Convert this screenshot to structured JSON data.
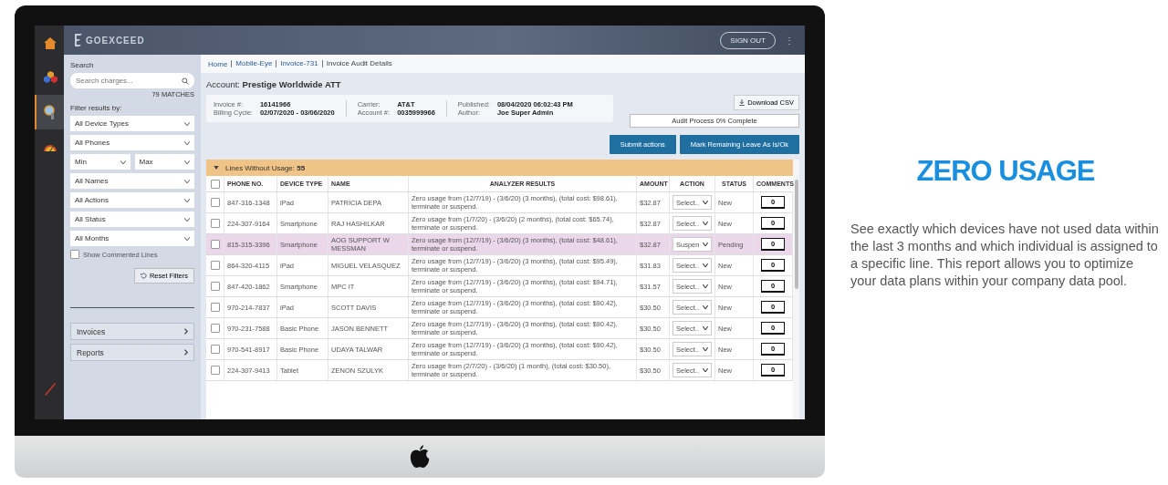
{
  "rail": [
    {
      "selected": false
    },
    {
      "selected": false
    },
    {
      "selected": true
    },
    {
      "selected": false
    },
    {
      "selected": false
    }
  ],
  "topbar": {
    "brand": "GOEXCEED",
    "sign_out": "SIGN OUT",
    "menu": "⋮"
  },
  "sidebar": {
    "search_label": "Search",
    "search": {
      "placeholder": "Search charges..."
    },
    "matches": "79 MATCHES",
    "filter_label": "Filter results by:",
    "filters": [
      {
        "kind": "select",
        "value": "All Device Types"
      },
      {
        "kind": "select",
        "value": "All Phones"
      },
      {
        "kind": "pair",
        "values": [
          "Min",
          "Max"
        ]
      },
      {
        "kind": "select",
        "value": "All Names"
      },
      {
        "kind": "select",
        "value": "All Actions"
      },
      {
        "kind": "select",
        "value": "All Status"
      },
      {
        "kind": "select",
        "value": "All Months"
      }
    ],
    "show_commented": {
      "label": "Show Commented Lines",
      "checked": false
    },
    "reset": "Reset Filters",
    "nav": [
      "Invoices",
      "Reports"
    ]
  },
  "breadcrumb": [
    {
      "label": "Home",
      "link": true
    },
    {
      "label": "Mobile-Eye",
      "link": true
    },
    {
      "label": "Invoice-731",
      "link": true
    },
    {
      "label": "Invoice Audit Details",
      "link": false
    }
  ],
  "account": "Account: **Prestige Worldwide ATT**",
  "invoice": [
    [
      {
        "label": "Invoice #:",
        "value": "16141966"
      },
      {
        "label": "Billing Cycle:",
        "value": "02/07/2020 - 03/06/2020"
      }
    ],
    [
      {
        "label": "Carrier:",
        "value": "AT&T"
      },
      {
        "label": "Account #:",
        "value": "0035999966"
      }
    ],
    [
      {
        "label": "Published:",
        "value": "08/04/2020 06:02:43 PM"
      },
      {
        "label": "Author:",
        "value": "Joe Super Admin"
      }
    ]
  ],
  "download": "Download CSV",
  "progress": {
    "label": "Audit Process 0% Complete",
    "level": 0
  },
  "actions": [
    "Submit actions",
    "Mark Remaining Leave As Is/Ok"
  ],
  "group": {
    "title": "Lines Without Usage: **55**",
    "expanded": true
  },
  "select_all": {
    "checked": false
  },
  "columns": [
    "PHONE NO.",
    "DEVICE TYPE",
    "NAME",
    "ANALYZER RESULTS",
    "AMOUNT",
    "ACTION",
    "STATUS",
    "COMMENTS"
  ],
  "rows": [
    {
      "phone": "847-316-1348",
      "device": "iPad",
      "name": "PATRICIA DEPA",
      "result": "Zero usage from (12/7/19) - (3/6/20) (3 months), (total cost: $98.61), terminate or suspend.",
      "amount": "$32.87",
      "action": "Select..",
      "status": "New",
      "comments": "0",
      "checked": false,
      "highlighted": false
    },
    {
      "phone": "224-307-9164",
      "device": "Smartphone",
      "name": "RAJ HASHILKAR",
      "result": "Zero usage from (1/7/20) - (3/6/20) (2 months), (total cost: $65.74), terminate or suspend.",
      "amount": "$32.87",
      "action": "Select..",
      "status": "New",
      "comments": "0",
      "checked": false,
      "highlighted": false
    },
    {
      "phone": "815-315-3396",
      "device": "Smartphone",
      "name": "AOG SUPPORT W MESSMAN",
      "result": "Zero usage from (12/7/19) - (3/6/20) (3 months), (total cost: $48.61), terminate or suspend.",
      "amount": "$32.87",
      "action": "Suspen",
      "status": "Pending",
      "comments": "0",
      "checked": false,
      "highlighted": true
    },
    {
      "phone": "864-320-4115",
      "device": "iPad",
      "name": "MIGUEL VELASQUEZ",
      "result": "Zero usage from (12/7/19) - (3/6/20) (3 months), (total cost: $95.49), terminate or suspend.",
      "amount": "$31.83",
      "action": "Select..",
      "status": "New",
      "comments": "0",
      "checked": false,
      "highlighted": false
    },
    {
      "phone": "847-420-1862",
      "device": "Smartphone",
      "name": "MPC IT",
      "result": "Zero usage from (12/7/19) - (3/6/20) (3 months), (total cost: $94.71), terminate or suspend.",
      "amount": "$31.57",
      "action": "Select..",
      "status": "New",
      "comments": "0",
      "checked": false,
      "highlighted": false
    },
    {
      "phone": "970-214-7837",
      "device": "iPad",
      "name": "SCOTT DAVIS",
      "result": "Zero usage from (12/7/19) - (3/6/20) (3 months), (total cost: $90.42), terminate or suspend.",
      "amount": "$30.50",
      "action": "Select..",
      "status": "New",
      "comments": "0",
      "checked": false,
      "highlighted": false
    },
    {
      "phone": "970-231-7588",
      "device": "Basic Phone",
      "name": "JASON BENNETT",
      "result": "Zero usage from (12/7/19) - (3/6/20) (3 months), (total cost: $90.42), terminate or suspend.",
      "amount": "$30.50",
      "action": "Select..",
      "status": "New",
      "comments": "0",
      "checked": false,
      "highlighted": false
    },
    {
      "phone": "970-541-8917",
      "device": "Basic Phone",
      "name": "UDAYA TALWAR",
      "result": "Zero usage from (12/7/19) - (3/6/20) (3 months), (total cost: $90.42), terminate or suspend.",
      "amount": "$30.50",
      "action": "Select..",
      "status": "New",
      "comments": "0",
      "checked": false,
      "highlighted": false
    },
    {
      "phone": "224-307-9413",
      "device": "Tablet",
      "name": "ZENON SZULYK",
      "result": "Zero usage from (2/7/20) - (3/6/20) (1 month), (total cost: $30.50), terminate or suspend.",
      "amount": "$30.50",
      "action": "Select..",
      "status": "New",
      "comments": "0",
      "checked": false,
      "highlighted": false
    }
  ],
  "promo": {
    "heading": "ZERO USAGE",
    "text": "See exactly which devices have not used data within the last 3 months and which individual is assigned to a specific line. This report allows you to optimize your data plans within your company data pool."
  }
}
